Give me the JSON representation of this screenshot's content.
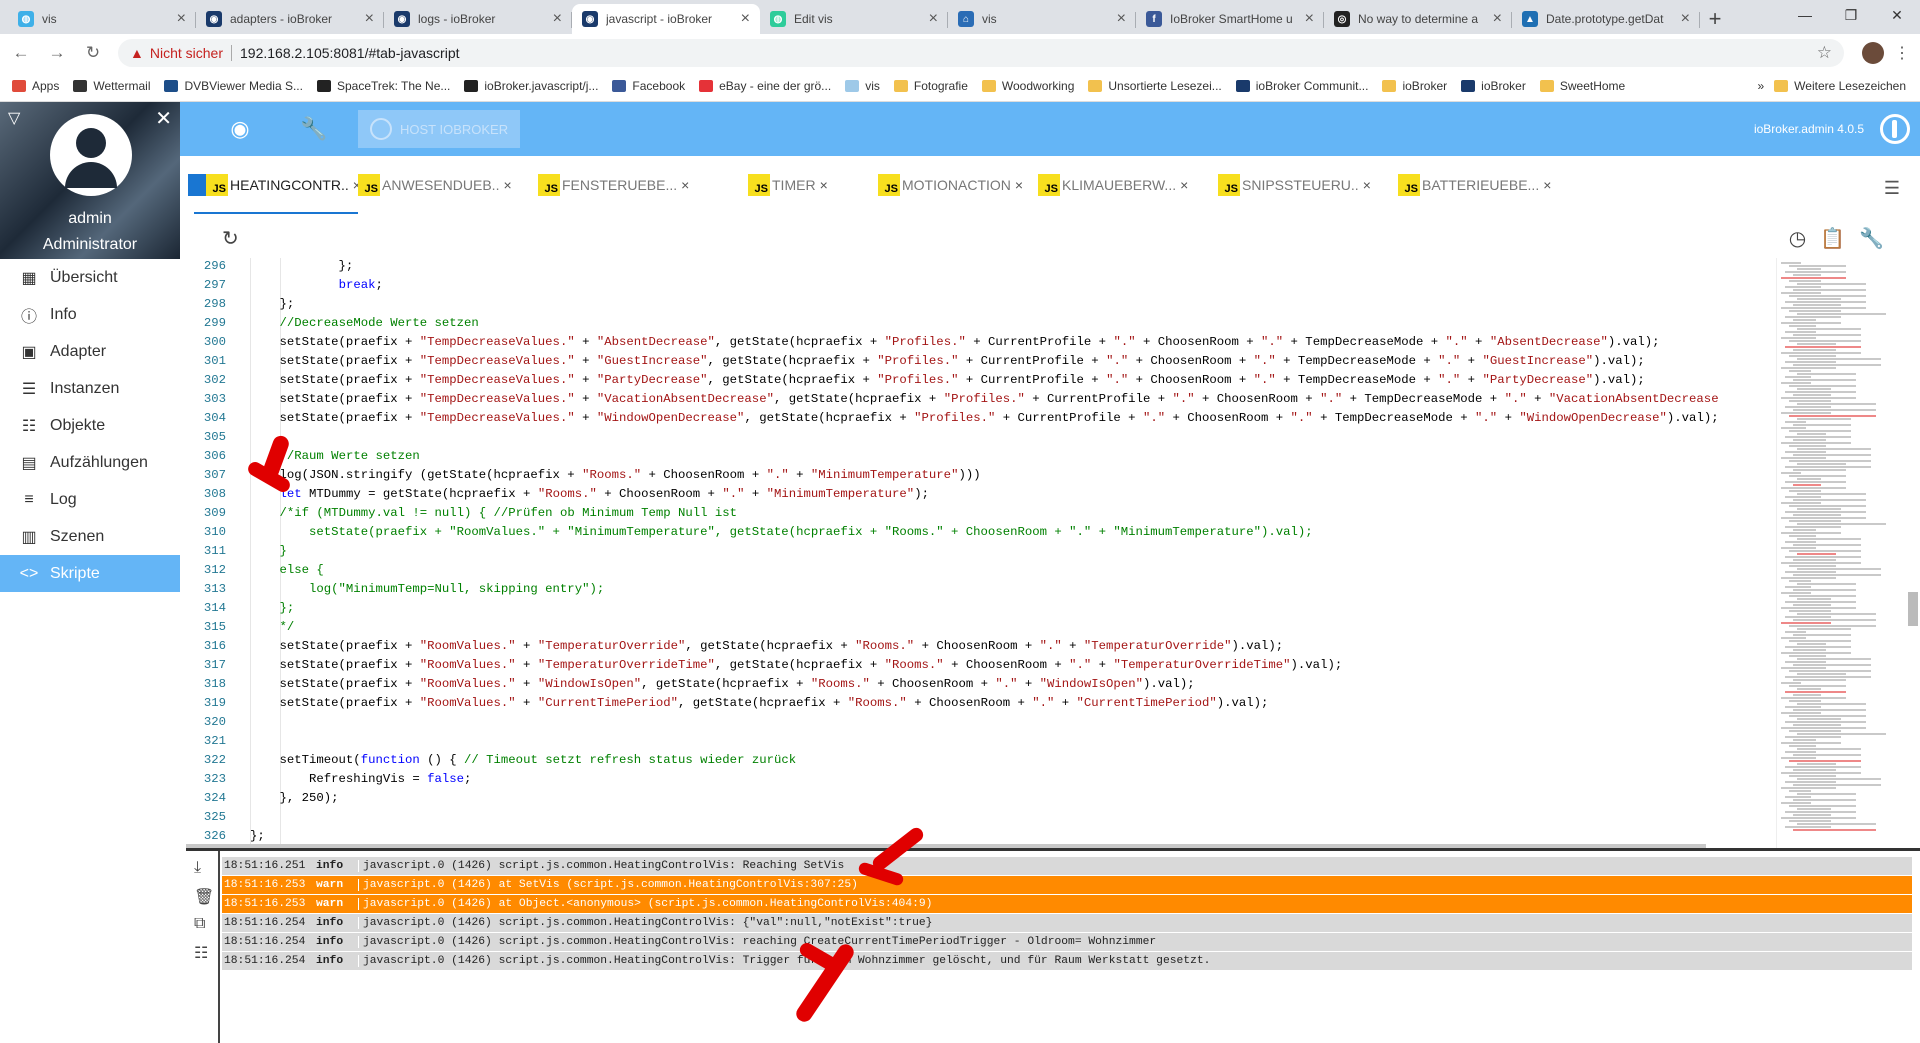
{
  "browser_tabs": [
    {
      "title": "vis",
      "fav": "#3fb0e8",
      "sym": "◍"
    },
    {
      "title": "adapters - ioBroker",
      "fav": "#1a3a6b",
      "sym": "◉"
    },
    {
      "title": "logs - ioBroker",
      "fav": "#1a3a6b",
      "sym": "◉"
    },
    {
      "title": "javascript - ioBroker",
      "fav": "#1a3a6b",
      "sym": "◉",
      "active": true
    },
    {
      "title": "Edit vis",
      "fav": "#2ecc9a",
      "sym": "◍"
    },
    {
      "title": "vis",
      "fav": "#2a6cb5",
      "sym": "⌂"
    },
    {
      "title": "IoBroker SmartHome u",
      "fav": "#3b5998",
      "sym": "f"
    },
    {
      "title": "No way to determine a",
      "fav": "#222222",
      "sym": "◎"
    },
    {
      "title": "Date.prototype.getDat",
      "fav": "#1f6fb3",
      "sym": "▲"
    }
  ],
  "address": {
    "warning": "Nicht sicher",
    "url": "192.168.2.105:8081/#tab-javascript"
  },
  "bookmarks": [
    {
      "label": "Apps",
      "color": "#e04b3b"
    },
    {
      "label": "Wettermail",
      "color": "#333333"
    },
    {
      "label": "DVBViewer Media S...",
      "color": "#1d4e89"
    },
    {
      "label": "SpaceTrek: The Ne...",
      "color": "#222222"
    },
    {
      "label": "ioBroker.javascript/j...",
      "color": "#222222"
    },
    {
      "label": "Facebook",
      "color": "#3b5998"
    },
    {
      "label": "eBay - eine der grö...",
      "color": "#e53238"
    },
    {
      "label": "vis",
      "color": "#9ec9e8"
    },
    {
      "label": "Fotografie",
      "color": "#f2c14e"
    },
    {
      "label": "Woodworking",
      "color": "#f2c14e"
    },
    {
      "label": "Unsortierte Lesezei...",
      "color": "#f2c14e"
    },
    {
      "label": "ioBroker Communit...",
      "color": "#1a3a6b"
    },
    {
      "label": "ioBroker",
      "color": "#f2c14e"
    },
    {
      "label": "ioBroker",
      "color": "#1a3a6b"
    },
    {
      "label": "SweetHome",
      "color": "#f2c14e"
    }
  ],
  "bookmarks_more": "»",
  "bookmarks_other": "Weitere Lesezeichen",
  "sidebar": {
    "user": "admin",
    "role": "Administrator",
    "items": [
      {
        "label": "Übersicht",
        "icon": "▦"
      },
      {
        "label": "Info",
        "icon": "ⓘ"
      },
      {
        "label": "Adapter",
        "icon": "▣"
      },
      {
        "label": "Instanzen",
        "icon": "☰"
      },
      {
        "label": "Objekte",
        "icon": "☷"
      },
      {
        "label": "Aufzählungen",
        "icon": "▤"
      },
      {
        "label": "Log",
        "icon": "≡"
      },
      {
        "label": "Szenen",
        "icon": "▥"
      },
      {
        "label": "Skripte",
        "icon": "<>",
        "selected": true
      }
    ]
  },
  "topbar": {
    "host": "HOST IOBROKER",
    "version": "ioBroker.admin 4.0.5"
  },
  "script_tabs": [
    {
      "label": "HEATINGCONTR..",
      "active": true
    },
    {
      "label": "ANWESENDUEB.."
    },
    {
      "label": "FENSTERUEBE..."
    },
    {
      "label": "TIMER"
    },
    {
      "label": "MOTIONACTION"
    },
    {
      "label": "KLIMAUEBERW..."
    },
    {
      "label": "SNIPSSTEUERU.."
    },
    {
      "label": "BATTERIEUEBE..."
    }
  ],
  "js_badge": "JS",
  "code": [
    {
      "n": "296",
      "html": "            };"
    },
    {
      "n": "297",
      "html": "            <span class='k'>break</span>;"
    },
    {
      "n": "298",
      "html": "    };"
    },
    {
      "n": "299",
      "html": "    <span class='c'>//DecreaseMode Werte setzen</span>"
    },
    {
      "n": "300",
      "html": "    setState(praefix + <span class='s'>\"TempDecreaseValues.\"</span> + <span class='s'>\"AbsentDecrease\"</span>, getState(hcpraefix + <span class='s'>\"Profiles.\"</span> + CurrentProfile + <span class='s'>\".\"</span> + ChoosenRoom + <span class='s'>\".\"</span> + TempDecreaseMode + <span class='s'>\".\"</span> + <span class='s'>\"AbsentDecrease\"</span>).val);"
    },
    {
      "n": "301",
      "html": "    setState(praefix + <span class='s'>\"TempDecreaseValues.\"</span> + <span class='s'>\"GuestIncrease\"</span>, getState(hcpraefix + <span class='s'>\"Profiles.\"</span> + CurrentProfile + <span class='s'>\".\"</span> + ChoosenRoom + <span class='s'>\".\"</span> + TempDecreaseMode + <span class='s'>\".\"</span> + <span class='s'>\"GuestIncrease\"</span>).val);"
    },
    {
      "n": "302",
      "html": "    setState(praefix + <span class='s'>\"TempDecreaseValues.\"</span> + <span class='s'>\"PartyDecrease\"</span>, getState(hcpraefix + <span class='s'>\"Profiles.\"</span> + CurrentProfile + <span class='s'>\".\"</span> + ChoosenRoom + <span class='s'>\".\"</span> + TempDecreaseMode + <span class='s'>\".\"</span> + <span class='s'>\"PartyDecrease\"</span>).val);"
    },
    {
      "n": "303",
      "html": "    setState(praefix + <span class='s'>\"TempDecreaseValues.\"</span> + <span class='s'>\"VacationAbsentDecrease\"</span>, getState(hcpraefix + <span class='s'>\"Profiles.\"</span> + CurrentProfile + <span class='s'>\".\"</span> + ChoosenRoom + <span class='s'>\".\"</span> + TempDecreaseMode + <span class='s'>\".\"</span> + <span class='s'>\"VacationAbsentDecrease</span>"
    },
    {
      "n": "304",
      "html": "    setState(praefix + <span class='s'>\"TempDecreaseValues.\"</span> + <span class='s'>\"WindowOpenDecrease\"</span>, getState(hcpraefix + <span class='s'>\"Profiles.\"</span> + CurrentProfile + <span class='s'>\".\"</span> + ChoosenRoom + <span class='s'>\".\"</span> + TempDecreaseMode + <span class='s'>\".\"</span> + <span class='s'>\"WindowOpenDecrease\"</span>).val);"
    },
    {
      "n": "305",
      "html": ""
    },
    {
      "n": "306",
      "html": "    <span class='c'>//Raum Werte setzen</span>"
    },
    {
      "n": "307",
      "html": "    log(JSON.stringify (getState(hcpraefix + <span class='s'>\"Rooms.\"</span> + ChoosenRoom + <span class='s'>\".\"</span> + <span class='s'>\"MinimumTemperature\"</span>)))"
    },
    {
      "n": "308",
      "html": "    <span class='k'>let</span> MTDummy = getState(hcpraefix + <span class='s'>\"Rooms.\"</span> + ChoosenRoom + <span class='s'>\".\"</span> + <span class='s'>\"MinimumTemperature\"</span>);"
    },
    {
      "n": "309",
      "html": "    <span class='c'>/*if (MTDummy.val != null) { //Prüfen ob Minimum Temp Null ist</span>"
    },
    {
      "n": "310",
      "html": "<span class='c'>        setState(praefix + \"RoomValues.\" + \"MinimumTemperature\", getState(hcpraefix + \"Rooms.\" + ChoosenRoom + \".\" + \"MinimumTemperature\").val);</span>"
    },
    {
      "n": "311",
      "html": "<span class='c'>    }</span>"
    },
    {
      "n": "312",
      "html": "<span class='c'>    else {</span>"
    },
    {
      "n": "313",
      "html": "<span class='c'>        log(\"MinimumTemp=Null, skipping entry\");</span>"
    },
    {
      "n": "314",
      "html": "<span class='c'>    };</span>"
    },
    {
      "n": "315",
      "html": "<span class='c'>    */</span>"
    },
    {
      "n": "316",
      "html": "    setState(praefix + <span class='s'>\"RoomValues.\"</span> + <span class='s'>\"TemperaturOverride\"</span>, getState(hcpraefix + <span class='s'>\"Rooms.\"</span> + ChoosenRoom + <span class='s'>\".\"</span> + <span class='s'>\"TemperaturOverride\"</span>).val);"
    },
    {
      "n": "317",
      "html": "    setState(praefix + <span class='s'>\"RoomValues.\"</span> + <span class='s'>\"TemperaturOverrideTime\"</span>, getState(hcpraefix + <span class='s'>\"Rooms.\"</span> + ChoosenRoom + <span class='s'>\".\"</span> + <span class='s'>\"TemperaturOverrideTime\"</span>).val);"
    },
    {
      "n": "318",
      "html": "    setState(praefix + <span class='s'>\"RoomValues.\"</span> + <span class='s'>\"WindowIsOpen\"</span>, getState(hcpraefix + <span class='s'>\"Rooms.\"</span> + ChoosenRoom + <span class='s'>\".\"</span> + <span class='s'>\"WindowIsOpen\"</span>).val);"
    },
    {
      "n": "319",
      "html": "    setState(praefix + <span class='s'>\"RoomValues.\"</span> + <span class='s'>\"CurrentTimePeriod\"</span>, getState(hcpraefix + <span class='s'>\"Rooms.\"</span> + ChoosenRoom + <span class='s'>\".\"</span> + <span class='s'>\"CurrentTimePeriod\"</span>).val);"
    },
    {
      "n": "320",
      "html": ""
    },
    {
      "n": "321",
      "html": ""
    },
    {
      "n": "322",
      "html": "    setTimeout(<span class='k'>function</span> () { <span class='c'>// Timeout setzt refresh status wieder zurück</span>"
    },
    {
      "n": "323",
      "html": "        RefreshingVis = <span class='k'>false</span>;"
    },
    {
      "n": "324",
      "html": "    }, 250);"
    },
    {
      "n": "325",
      "html": ""
    },
    {
      "n": "326",
      "html": "};"
    }
  ],
  "log": [
    {
      "time": "18:51:16.251",
      "level": "info",
      "msg": "javascript.0 (1426) script.js.common.HeatingControlVis: Reaching SetVis"
    },
    {
      "time": "18:51:16.253",
      "level": "warn",
      "msg": "javascript.0 (1426) at SetVis (script.js.common.HeatingControlVis:307:25)"
    },
    {
      "time": "18:51:16.253",
      "level": "warn",
      "msg": "javascript.0 (1426) at Object.<anonymous> (script.js.common.HeatingControlVis:404:9)"
    },
    {
      "time": "18:51:16.254",
      "level": "info",
      "msg": "javascript.0 (1426) script.js.common.HeatingControlVis: {\"val\":null,\"notExist\":true}"
    },
    {
      "time": "18:51:16.254",
      "level": "info",
      "msg": "javascript.0 (1426) script.js.common.HeatingControlVis: reaching CreateCurrentTimePeriodTrigger - Oldroom= Wohnzimmer"
    },
    {
      "time": "18:51:16.254",
      "level": "info",
      "msg": "javascript.0 (1426) script.js.common.HeatingControlVis: Trigger für Raum Wohnzimmer gelöscht, und für Raum Werkstatt gesetzt."
    }
  ]
}
